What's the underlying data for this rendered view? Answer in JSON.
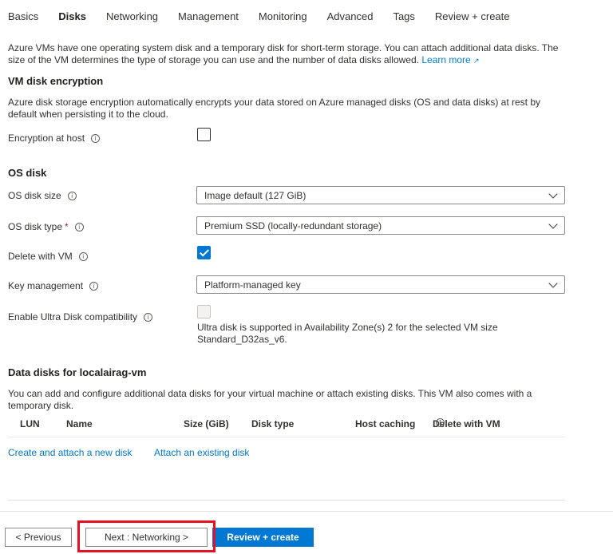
{
  "tabs": [
    {
      "label": "Basics"
    },
    {
      "label": "Disks"
    },
    {
      "label": "Networking"
    },
    {
      "label": "Management"
    },
    {
      "label": "Monitoring"
    },
    {
      "label": "Advanced"
    },
    {
      "label": "Tags"
    },
    {
      "label": "Review + create"
    }
  ],
  "active_tab": "Disks",
  "intro": {
    "text": "Azure VMs have one operating system disk and a temporary disk for short-term storage. You can attach additional data disks. The size of the VM determines the type of storage you can use and the number of data disks allowed.",
    "learn_more": "Learn more"
  },
  "encryption": {
    "heading": "VM disk encryption",
    "description": "Azure disk storage encryption automatically encrypts your data stored on Azure managed disks (OS and data disks) at rest by default when persisting it to the cloud.",
    "host_label": "Encryption at host",
    "host_checked": false
  },
  "os_disk": {
    "heading": "OS disk",
    "size_label": "OS disk size",
    "size_value": "Image default (127 GiB)",
    "type_label": "OS disk type",
    "type_required": "*",
    "type_value": "Premium SSD (locally-redundant storage)",
    "delete_label": "Delete with VM",
    "delete_checked": true,
    "key_label": "Key management",
    "key_value": "Platform-managed key",
    "ultra_label": "Enable Ultra Disk compatibility",
    "ultra_checked": false,
    "ultra_note_line1": "Ultra disk is supported in Availability Zone(s) 2 for the selected VM size",
    "ultra_note_line2": "Standard_D32as_v6."
  },
  "data_disks": {
    "heading": "Data disks for localairag-vm",
    "description": "You can add and configure additional data disks for your virtual machine or attach existing disks. This VM also comes with a temporary disk.",
    "columns": [
      "LUN",
      "Name",
      "Size (GiB)",
      "Disk type",
      "Host caching",
      "Delete with VM"
    ],
    "create_link": "Create and attach a new disk",
    "attach_link": "Attach an existing disk"
  },
  "footer": {
    "previous": "< Previous",
    "next": "Next : Networking >",
    "review": "Review + create"
  },
  "colors": {
    "accent": "#0078d4",
    "highlight": "#e81123"
  }
}
